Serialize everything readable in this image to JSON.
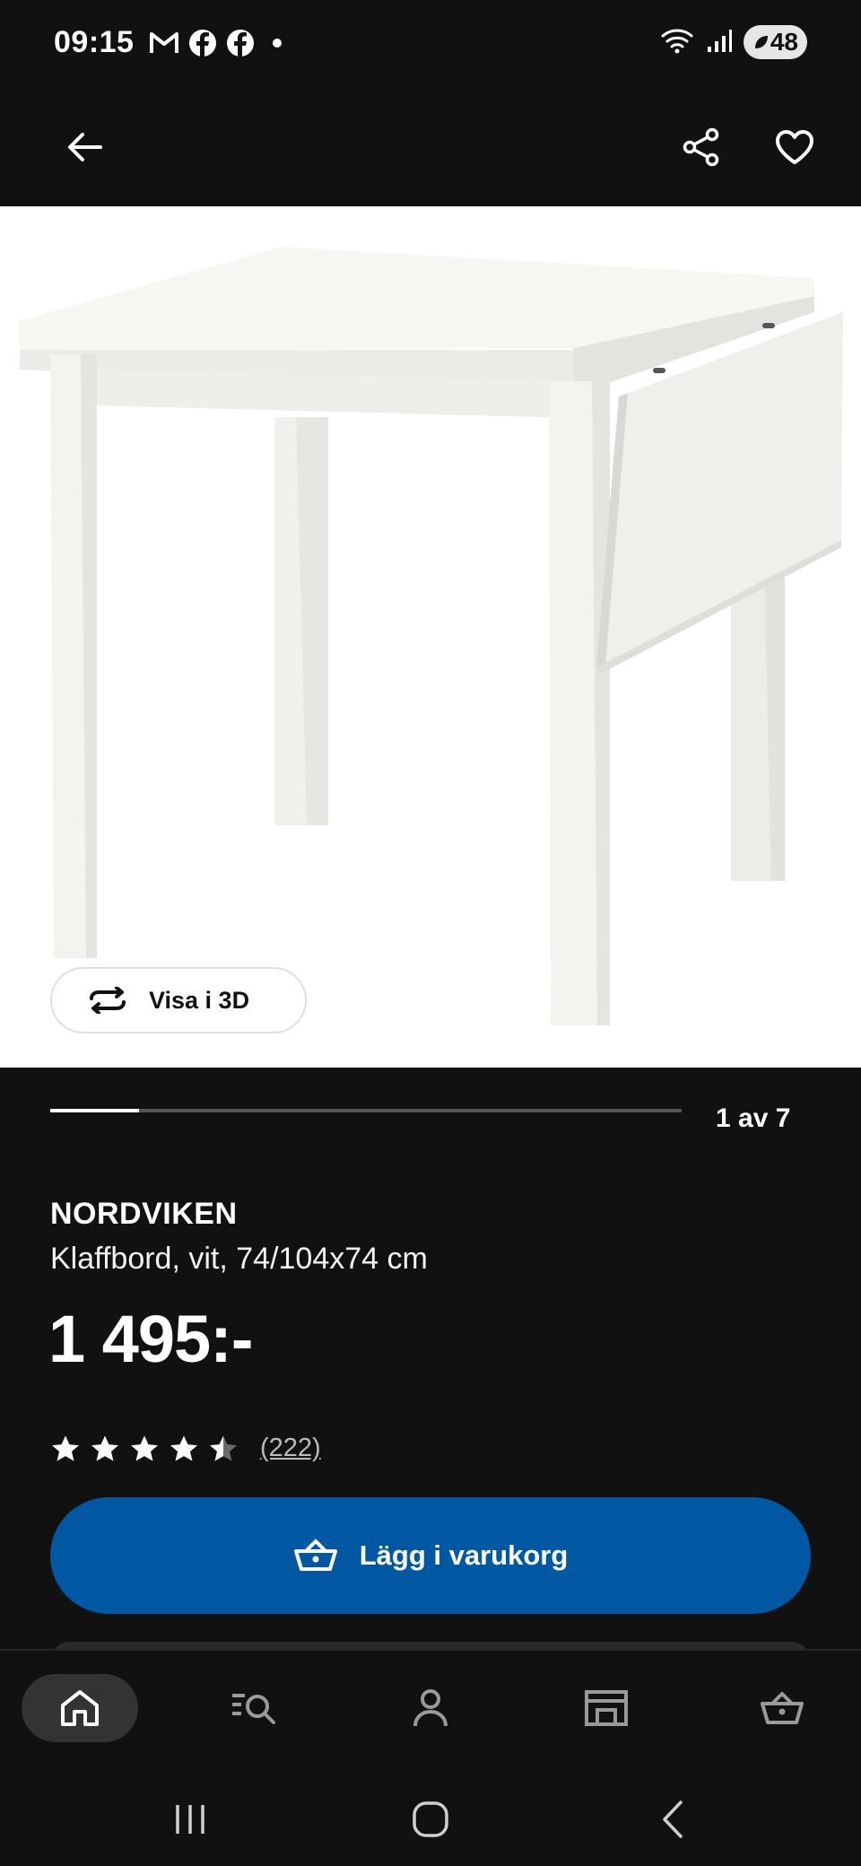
{
  "status_bar": {
    "time": "09:15",
    "notification_icons": [
      "gmail-icon",
      "facebook-icon",
      "facebook-icon",
      "dot-icon"
    ],
    "battery": "48"
  },
  "top_bar": {
    "icons": [
      "back-arrow-icon",
      "share-icon",
      "heart-icon"
    ]
  },
  "hero": {
    "view_3d_label": "Visa i 3D"
  },
  "carousel": {
    "counter": "1 av 7",
    "progress_fraction": 0.14
  },
  "product": {
    "name": "NORDVIKEN",
    "description": "Klaffbord, vit, 74/104x74 cm",
    "price": "1 495:-",
    "rating": 4.5,
    "review_count": "(222)"
  },
  "actions": {
    "add_to_cart": "Lägg i varukorg"
  },
  "bottom_nav": {
    "items": [
      "home-icon",
      "search-list-icon",
      "profile-icon",
      "store-icon",
      "basket-icon"
    ],
    "active": "home-icon"
  },
  "system_nav": [
    "recents-icon",
    "home-circle-icon",
    "back-chevron-icon"
  ],
  "colors": {
    "background": "#111111",
    "accent_blue": "#0058a3",
    "text": "#ffffff"
  }
}
